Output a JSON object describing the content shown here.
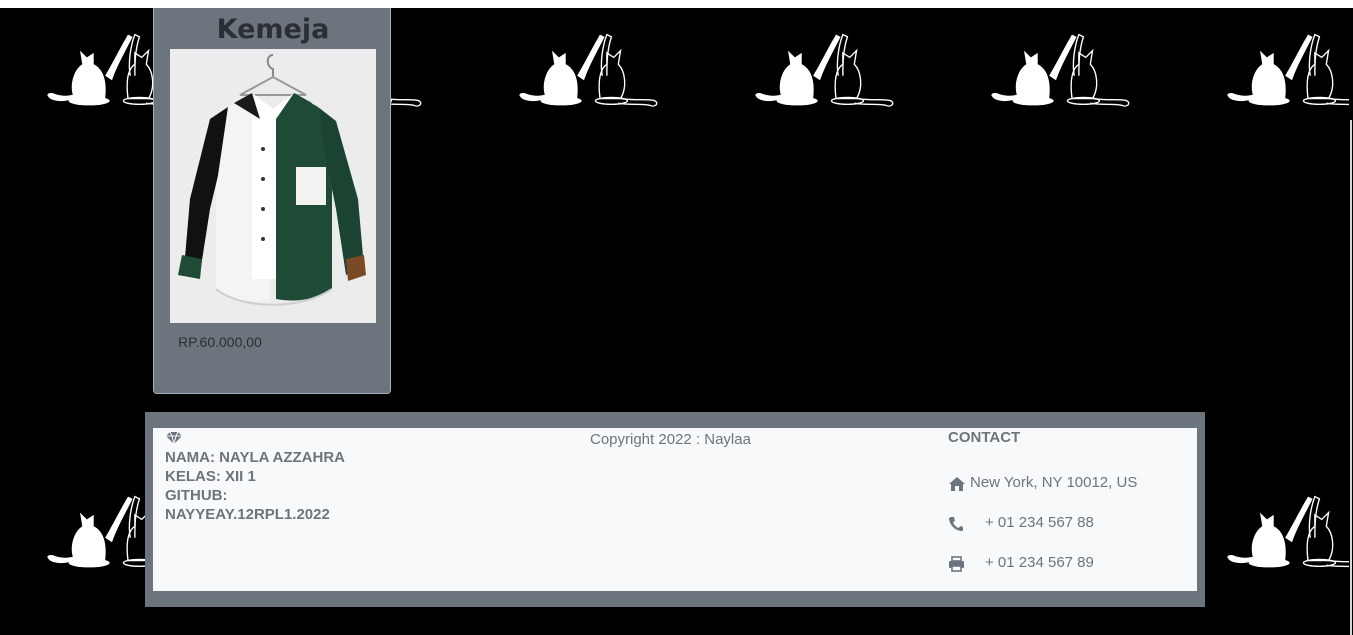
{
  "product": {
    "title": "Kemeja",
    "price": "RP.60.000,00"
  },
  "footer": {
    "identity": {
      "name": "NAMA: NAYLA AZZAHRA",
      "class": "KELAS: XII 1",
      "github_label": "GITHUB:",
      "github_value": "NAYYEAY.12RPL1.2022"
    },
    "copyright": "Copyright 2022 : Naylaa",
    "contact": {
      "heading": "CONTACT",
      "address": "New York, NY 10012, US",
      "phone": "+ 01 234 567 88",
      "fax": "+ 01 234 567 89"
    }
  },
  "icons": {
    "brand": "gem-icon",
    "address": "home-icon",
    "phone": "phone-icon",
    "fax": "print-icon"
  },
  "colors": {
    "background": "#000000",
    "card": "#6c757d",
    "footer_frame": "#6c757d",
    "footer_panel": "#f8f9fa",
    "text_muted": "#6c757d"
  }
}
